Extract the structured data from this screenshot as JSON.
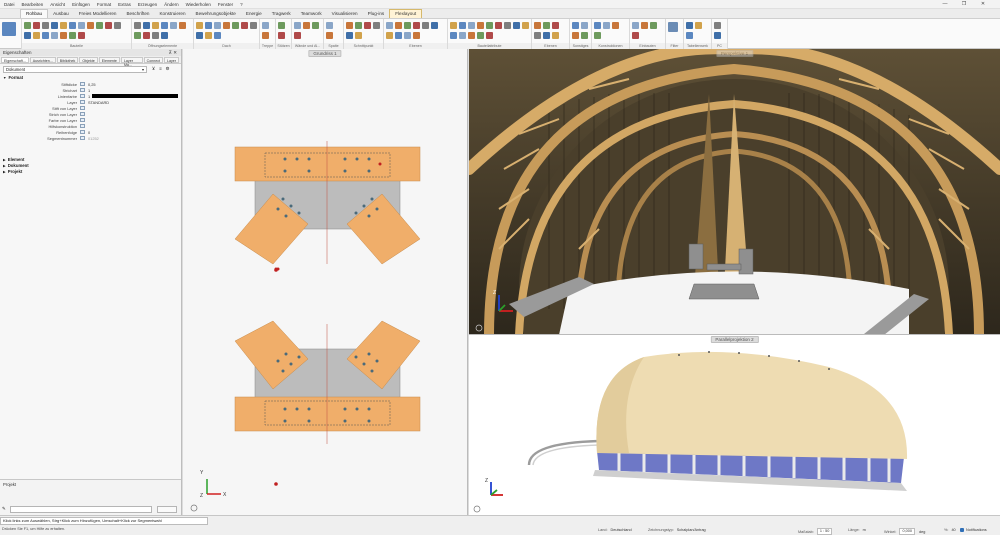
{
  "menu": [
    "Datei",
    "Bearbeiten",
    "Ansicht",
    "Einfügen",
    "Format",
    "Extras",
    "Erzeugen",
    "Ändern",
    "Wiederholen",
    "Fenster",
    "?"
  ],
  "window_controls": [
    "—",
    "❐",
    "✕"
  ],
  "tabs": [
    "Rohbau",
    "Ausbau",
    "Freies Modellieren",
    "Beschriften",
    "Konstruieren",
    "Bewehrungsobjekte",
    "Energie",
    "Tragwerk",
    "Teamwork",
    "Visualisieren",
    "Plug-ins",
    "Flexlayout"
  ],
  "active_tab": "Rohbau",
  "ribbon_groups": [
    "Bauteile",
    "Öffnungselemente",
    "Dach",
    "Treppe",
    "Stützen",
    "Wände und Al...",
    "Spalte",
    "Schnittpunkt",
    "Ebenen",
    "Bauteilattribute",
    "Ebenen",
    "Sonstiges",
    "Konstruktionen",
    "Einbauten",
    "Filter",
    "Tabellenwerk",
    "PC"
  ],
  "panel": {
    "title": "Eigenschaften",
    "pin": "⊼ ✕",
    "tabs": [
      "Eigenschaft...",
      "Ausrichten...",
      "Bibliothek",
      "Objekte",
      "Elemente",
      "Layer Ma...",
      "Connect",
      "Layer"
    ],
    "select_value": "Dokument",
    "section_format": "Format",
    "rows": [
      {
        "label": "Stiftdicke",
        "value": "0,25"
      },
      {
        "label": "Strichart",
        "value": "1"
      },
      {
        "label": "Linienfarbe",
        "value": "1"
      },
      {
        "label": "Layer",
        "value": "STANDARD"
      },
      {
        "label": "Stift von Layer",
        "value": ""
      },
      {
        "label": "Strich von Layer",
        "value": ""
      },
      {
        "label": "Farbe von Layer",
        "value": ""
      },
      {
        "label": "Hilfskonstruktion",
        "value": ""
      },
      {
        "label": "Reihenfolge",
        "value": "0"
      },
      {
        "label": "Segmentnummer",
        "value": "01252"
      }
    ],
    "section_element": "Element",
    "section_document": "Dokument",
    "section_project": "Projekt",
    "bottom_label": "Projekt"
  },
  "viewports": {
    "left_title": "Grundriss 1",
    "top_title": "Perspektive 1",
    "bottom_title": "Parallelprojektion 2"
  },
  "status": {
    "hint": "Klick links zum Auswählen, Strg+Klick zum Hinzufügen, Umschalt+Klick zur Segmentwahl",
    "help": "Drücken Sie F1, um Hilfe zu erhalten.",
    "country_label": "Land:",
    "country": "Deutschland",
    "drawing_type_label": "Zeichnungstyp:",
    "drawing_type": "Schalplan/Antrag",
    "scale_label": "Maßstab:",
    "scale": "1 : 50",
    "length_label": "Länge:",
    "length_unit": "m",
    "angle_label": "Winkel:",
    "angle": "0,000",
    "angle_unit": "deg",
    "percent_label": "%:",
    "percent": "40",
    "notifications": "Notifications"
  },
  "colors": {
    "timber": "#f0ae6a",
    "plate": "#bcbcbc",
    "dome_roof": "#eedcb2",
    "facade": "#6e78c6"
  }
}
